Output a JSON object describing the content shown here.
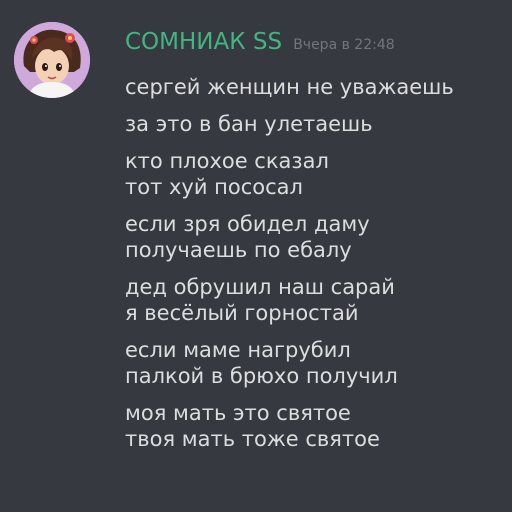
{
  "message": {
    "author": "СОМНИАК SS",
    "timestamp": "Вчера в 22:48",
    "author_color": "#43b581",
    "text_color": "#dcddde",
    "background_color": "#36393f",
    "blocks": [
      [
        "сергей женщин не уважаешь"
      ],
      [
        "за это в бан улетаешь"
      ],
      [
        "кто плохое сказал",
        "тот хуй пососал"
      ],
      [
        "если зря обидел даму",
        "получаешь по ебалу"
      ],
      [
        "дед обрушил наш сарай",
        "я весёлый горностай"
      ],
      [
        "если маме нагрубил",
        "палкой в брюхо получил"
      ],
      [
        "моя мать это святое",
        "твоя мать тоже святое"
      ]
    ]
  }
}
